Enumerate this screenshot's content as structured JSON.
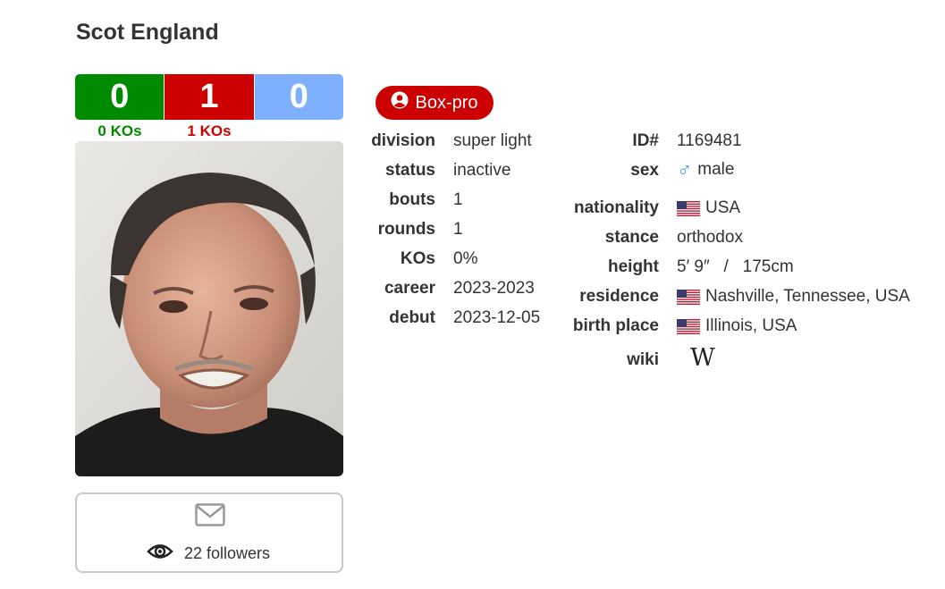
{
  "boxer": {
    "name": "Scot England"
  },
  "record": {
    "wins": "0",
    "losses": "1",
    "draws": "0",
    "wins_kos": "0 KOs",
    "losses_kos": "1 KOs",
    "colors": {
      "win": "#008a00",
      "loss": "#cc0000",
      "draw": "#7fb0ff",
      "win_ko_text": "#008a00",
      "loss_ko_text": "#cc0000"
    }
  },
  "badge": {
    "label": "Box-pro",
    "icon": "user-circle-icon",
    "color": "#cc0000"
  },
  "details_left": [
    {
      "label": "division",
      "value": "super light"
    },
    {
      "label": "status",
      "value": "inactive"
    },
    {
      "label": "bouts",
      "value": "1"
    },
    {
      "label": "rounds",
      "value": "1"
    },
    {
      "label": "KOs",
      "value": "0%"
    },
    {
      "label": "career",
      "value": "2023-2023"
    },
    {
      "label": "debut",
      "value": "2023-12-05"
    }
  ],
  "details_right": {
    "id": {
      "label": "ID#",
      "value": "1169481"
    },
    "sex": {
      "label": "sex",
      "value": "male",
      "icon": "male-symbol-icon"
    },
    "nationality": {
      "label": "nationality",
      "value": "USA",
      "icon": "us-flag-icon"
    },
    "stance": {
      "label": "stance",
      "value": "orthodox"
    },
    "height": {
      "label": "height",
      "value": "5′ 9″   /   175cm"
    },
    "residence": {
      "label": "residence",
      "value": "Nashville, Tennessee, USA",
      "icon": "us-flag-icon"
    },
    "birth_place": {
      "label": "birth place",
      "value": "Illinois, USA",
      "icon": "us-flag-icon"
    },
    "wiki": {
      "label": "wiki",
      "icon": "wikipedia-icon"
    }
  },
  "follow": {
    "count_text": "22 followers",
    "mail_icon": "envelope-icon",
    "eye_icon": "eye-icon"
  }
}
